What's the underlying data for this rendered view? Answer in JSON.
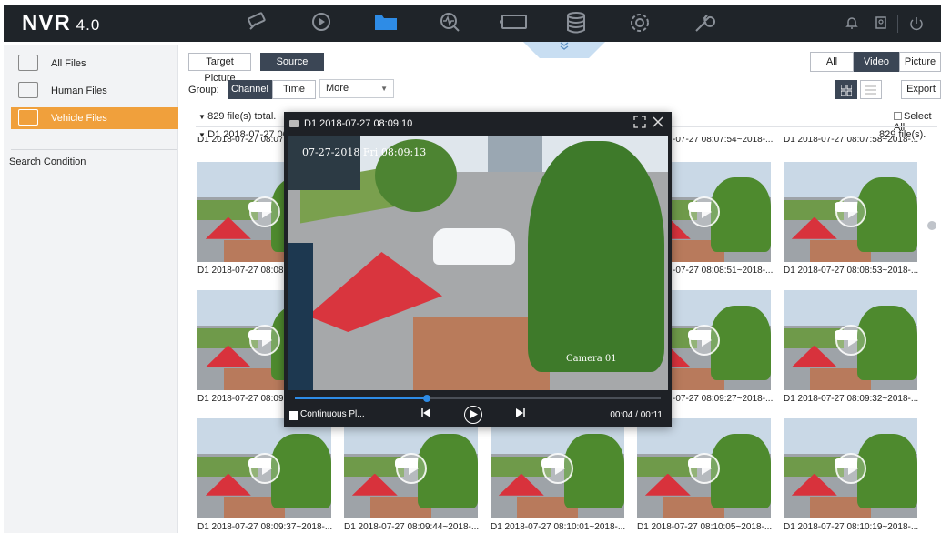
{
  "app": {
    "logo": "NVR",
    "version": "4.0"
  },
  "topnav": {
    "icons": [
      "live-view-icon",
      "playback-icon",
      "file-management-icon",
      "smart-analysis-icon",
      "camera-icon",
      "storage-icon",
      "system-settings-icon",
      "maintenance-icon"
    ],
    "active": "file-management-icon",
    "right_icons": [
      "notification-icon",
      "account-icon",
      "power-icon"
    ]
  },
  "sidebar": {
    "items": [
      {
        "label": "All Files",
        "icon": "all-files-icon"
      },
      {
        "label": "Human Files",
        "icon": "human-files-icon"
      },
      {
        "label": "Vehicle Files",
        "icon": "vehicle-files-icon",
        "active": true
      }
    ],
    "search_condition": "Search Condition"
  },
  "toolbar": {
    "target_picture": "Target Picture",
    "source_picture": "Source Picture",
    "group_label": "Group:",
    "group_tabs": [
      "Channel",
      "Time"
    ],
    "more_select": "More",
    "type_tabs": [
      "All",
      "Video",
      "Picture"
    ],
    "active_type": "Video",
    "export": "Export"
  },
  "summary": {
    "total": "829 file(s) total.",
    "select_all": "Select All",
    "group_header": "D1 2018-07-27 00:0",
    "group_count": "829 file(s)."
  },
  "thumbnails": {
    "captions": [
      "D1 2018-07-27 08:08...",
      "D1 2018-07-27 08:08:51~2018-...",
      "D1 2018-07-27 08:08:53~2018-...",
      "D1 2018-07-27 08:09:...",
      "D1 2018-07-27 08:09:27~2018-...",
      "D1 2018-07-27 08:09:32~2018-...",
      "D1 2018-07-27 08:09:37~2018-...",
      "D1 2018-07-27 08:09:44~2018-...",
      "D1 2018-07-27 08:10:01~2018-...",
      "D1 2018-07-27 08:10:05~2018-...",
      "D1 2018-07-27 08:10:19~2018-..."
    ],
    "partial_top": [
      "-07-27 08:07:54~2018-...",
      "D1 2018-07-27 08:07:58~2018-..."
    ],
    "partial_left": "D1 2018-07-27 08:07",
    "overlay_captions": [
      "-07-27 08:08:51~2018-...",
      "-07-27 08:09:27~2018-..."
    ]
  },
  "player": {
    "title": "D1 2018-07-27 08:09:10",
    "video_timestamp": "07-27-2018 Fri 08:09:13",
    "camera_label": "Camera 01",
    "continuous_play": "Continuous Pl...",
    "time": "00:04 / 00:11",
    "progress": 0.36
  },
  "colors": {
    "accent": "#2e8ce6",
    "active_side": "#f0a03c",
    "topbar": "#1f2429"
  }
}
